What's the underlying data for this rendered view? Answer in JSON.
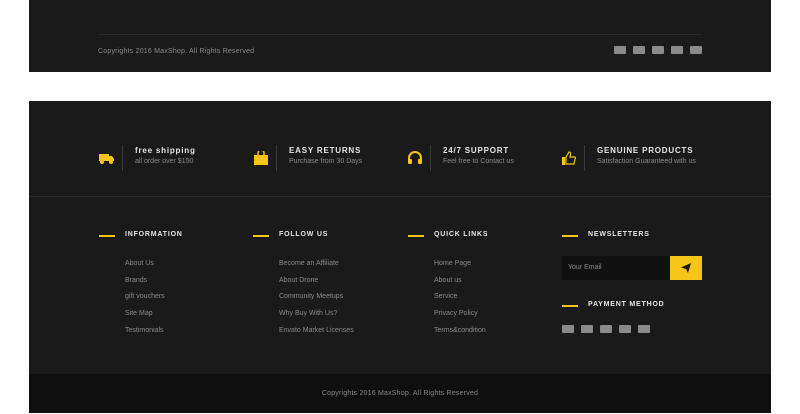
{
  "top_footer": {
    "copyright": "Copyrights 2016 MaxShop. All Rights Reserved",
    "payment_icons": [
      "visa-icon",
      "mastercard-icon",
      "discover-icon",
      "paypal-icon",
      "maestro-icon"
    ]
  },
  "features": [
    {
      "icon": "truck-icon",
      "title": "free shipping",
      "subtitle": "all order over $150"
    },
    {
      "icon": "shopping-bag-icon",
      "title": "EASY RETURNS",
      "subtitle": "Purchase from 30 Days"
    },
    {
      "icon": "headphones-icon",
      "title": "24/7 SUPPORT",
      "subtitle": "Feel free to Contact us"
    },
    {
      "icon": "thumbs-up-icon",
      "title": "GENUINE PRODUCTS",
      "subtitle": "Satisfaction Guaranteed with us"
    }
  ],
  "columns": {
    "information": {
      "title": "INFORMATION",
      "items": [
        "About Us",
        "Brands",
        "gift vouchers",
        "Site Map",
        "Testimonials"
      ]
    },
    "follow_us": {
      "title": "FOLLOW US",
      "items": [
        "Become an Affiliate",
        "About Drone",
        "Community Meetups",
        "Why Buy With Us?",
        "Envato Market Licenses"
      ]
    },
    "quick_links": {
      "title": "QUICK LINKS",
      "items": [
        "Home Page",
        "About us",
        "Service",
        "Privacy Policy",
        "Terms&condition"
      ]
    }
  },
  "newsletter": {
    "title": "NEWSLETTERS",
    "placeholder": "Your Email"
  },
  "payment": {
    "title": "PAYMENT METHOD",
    "icons": [
      "visa-icon",
      "mastercard-icon",
      "discover-icon",
      "paypal-icon",
      "maestro-icon"
    ]
  },
  "bottom": {
    "copyright": "Copyrights 2016 MaxShop. All Rights Reserved"
  },
  "colors": {
    "accent": "#f5c518",
    "background": "#1a1a1a",
    "bottom_bar": "#0f0f0f"
  }
}
